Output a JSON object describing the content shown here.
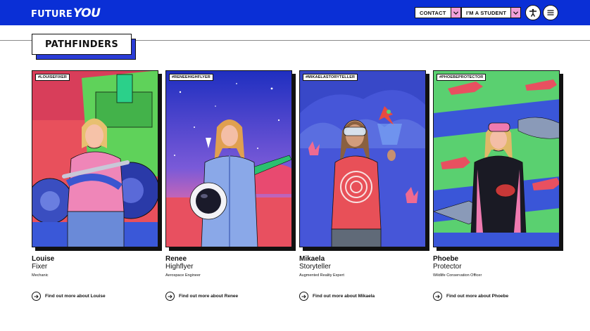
{
  "header": {
    "logo_part1": "FUTURE",
    "logo_part2": "YOU",
    "contact_label": "CONTACT",
    "student_label": "I'M A STUDENT",
    "accessibility_icon": "accessibility-icon",
    "menu_icon": "hamburger-menu-icon"
  },
  "colors": {
    "brand_blue": "#0a2fd6",
    "accent_pink": "#f09fd8"
  },
  "section": {
    "title": "PATHFINDERS"
  },
  "cards": [
    {
      "tag": "#LOUISEFIXER",
      "name": "Louise",
      "role": "Fixer",
      "job": "Mechanic",
      "link": "Find out more about Louise"
    },
    {
      "tag": "#RENEEHIGHFLYER",
      "name": "Renee",
      "role": "Highflyer",
      "job": "Aerospace Engineer",
      "link": "Find out more about Renee"
    },
    {
      "tag": "#MIKAELASTORYTELLER",
      "name": "Mikaela",
      "role": "Storyteller",
      "job": "Augmented Reality Expert",
      "link": "Find out more about Mikaela"
    },
    {
      "tag": "#PHOEBEPROTECTOR",
      "name": "Phoebe",
      "role": "Protector",
      "job": "Wildlife Conservation Officer",
      "link": "Find out more about Phoebe"
    }
  ]
}
